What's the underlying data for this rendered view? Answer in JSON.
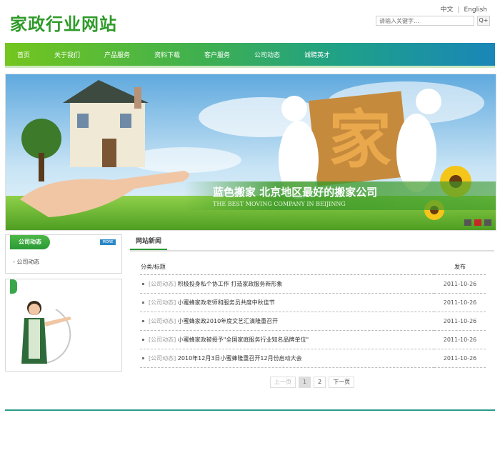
{
  "header": {
    "logo": "家政行业网站",
    "lang_cn": "中文",
    "lang_sep": "|",
    "lang_en": "English",
    "search_placeholder": "请输入关键字...",
    "search_btn": "Q+"
  },
  "nav": {
    "items": [
      "首页",
      "关于我们",
      "产品服务",
      "资料下载",
      "客户服务",
      "公司动态",
      "诚聘英才"
    ]
  },
  "banner": {
    "headline": "蓝色搬家   北京地区最好的搬家公司",
    "subline": "THE BEST MOVING COMPANY IN BEIJINNG",
    "center_glyph": "家"
  },
  "sidebar": {
    "section1_title": "公司动态",
    "more": "MORE",
    "item1": "- 公司动态"
  },
  "news": {
    "title": "网站新闻",
    "col_title": "分类/标题",
    "col_date": "发布",
    "rows": [
      {
        "cat": "[公司动态]",
        "title": "积极投身私个协工作 打造家政服务新形象",
        "date": "2011-10-26"
      },
      {
        "cat": "[公司动态]",
        "title": "小蜜蜂家政老师和服务员共度中秋佳节",
        "date": "2011-10-26"
      },
      {
        "cat": "[公司动态]",
        "title": "小蜜蜂家政2010年度文艺汇演隆重召开",
        "date": "2011-10-26"
      },
      {
        "cat": "[公司动态]",
        "title": "小蜜蜂家政被授予\"全国家庭服务行业知名品牌单位\"",
        "date": "2011-10-26"
      },
      {
        "cat": "[公司动态]",
        "title": "2010年12月3日小蜜蜂隆重召开12月份启动大会",
        "date": "2011-10-26"
      }
    ]
  },
  "pager": {
    "prev": "上一页",
    "p1": "1",
    "p2": "2",
    "next": "下一页"
  }
}
